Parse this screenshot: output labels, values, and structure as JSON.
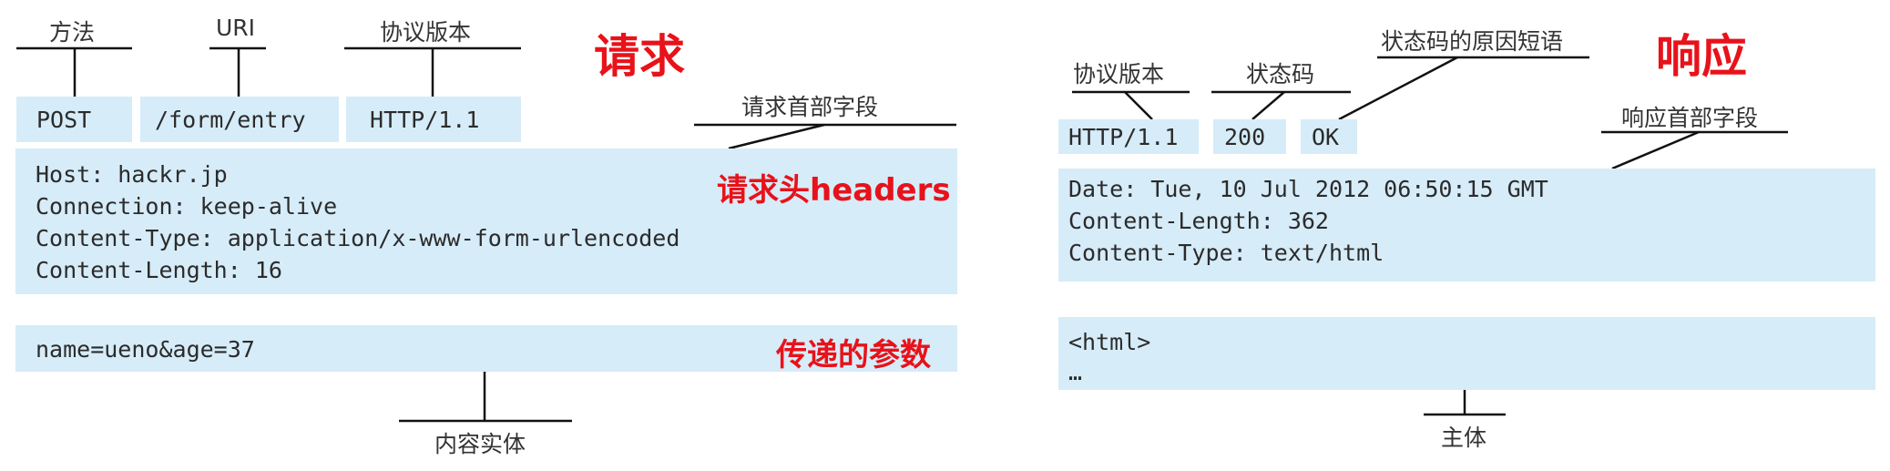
{
  "request": {
    "title": "请求",
    "labels": {
      "method": "方法",
      "uri": "URI",
      "version": "协议版本",
      "headers": "请求首部字段",
      "body": "内容实体"
    },
    "line": {
      "method": "POST",
      "uri": "/form/entry",
      "version": "HTTP/1.1"
    },
    "headers": [
      "Host: hackr.jp",
      "Connection: keep-alive",
      "Content-Type: application/x-www-form-urlencoded",
      "Content-Length: 16"
    ],
    "headers_annotation": "请求头headers",
    "body": "name=ueno&age=37",
    "body_annotation": "传递的参数"
  },
  "response": {
    "title": "响应",
    "labels": {
      "version": "协议版本",
      "status": "状态码",
      "reason": "状态码的原因短语",
      "headers": "响应首部字段",
      "body": "主体"
    },
    "line": {
      "version": "HTTP/1.1",
      "status": "200",
      "reason": "OK"
    },
    "headers": [
      "Date: Tue, 10 Jul 2012 06:50:15 GMT",
      "Content-Length: 362",
      "Content-Type: text/html"
    ],
    "body": [
      "<html>",
      "…"
    ]
  },
  "colors": {
    "box": "#d6ecf8",
    "accent": "#e8121a",
    "line": "#111111"
  }
}
